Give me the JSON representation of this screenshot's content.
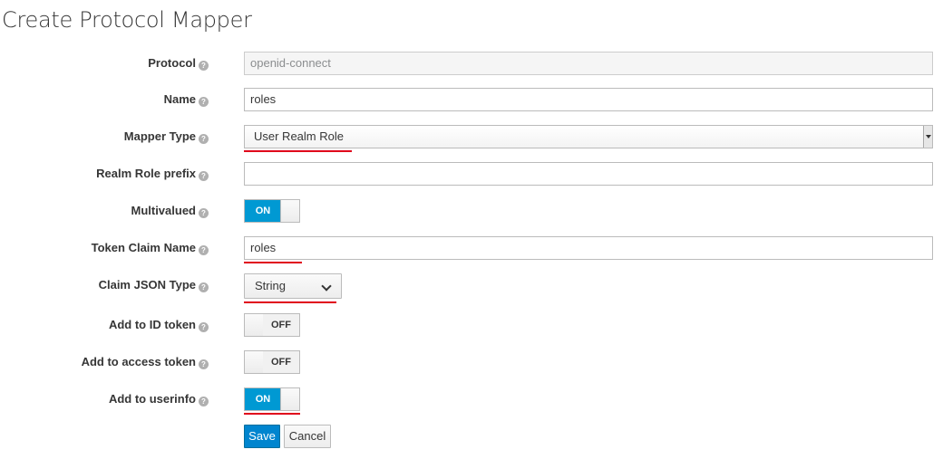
{
  "page": {
    "title": "Create Protocol Mapper"
  },
  "form": {
    "protocol": {
      "label": "Protocol",
      "value": "openid-connect"
    },
    "name": {
      "label": "Name",
      "value": "roles"
    },
    "mapper_type": {
      "label": "Mapper Type",
      "value": "User Realm Role"
    },
    "realm_role_prefix": {
      "label": "Realm Role prefix",
      "value": ""
    },
    "multivalued": {
      "label": "Multivalued",
      "state": "ON"
    },
    "token_claim_name": {
      "label": "Token Claim Name",
      "value": "roles"
    },
    "claim_json_type": {
      "label": "Claim JSON Type",
      "value": "String"
    },
    "add_to_id_token": {
      "label": "Add to ID token",
      "state": "OFF"
    },
    "add_to_access_token": {
      "label": "Add to access token",
      "state": "OFF"
    },
    "add_to_userinfo": {
      "label": "Add to userinfo",
      "state": "ON"
    }
  },
  "icons": {
    "help": "question-circle-icon",
    "help_glyph": "?",
    "chevron": "chevron-down-icon",
    "select_arrow": "select-arrow-icon"
  },
  "actions": {
    "save_label": "Save",
    "cancel_label": "Cancel"
  },
  "colors": {
    "accent": "#0099d3",
    "primary_button": "#0085cf",
    "highlight_underline": "#e0001b"
  }
}
